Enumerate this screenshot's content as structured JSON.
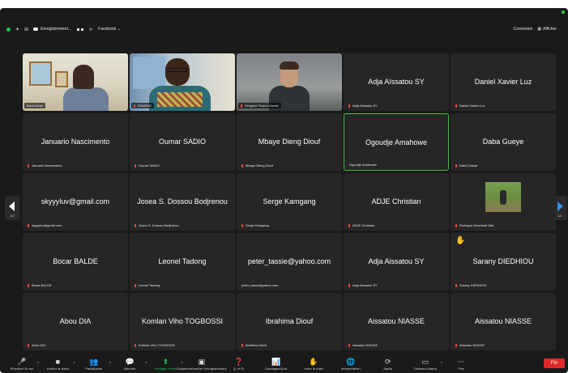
{
  "topbar": {
    "recording": "Enregistrement...",
    "view_menu": "Facebook",
    "sign_in": "Connexion",
    "view_toggle": "Afficher"
  },
  "grid": [
    [
      {
        "kind": "video",
        "video": "vid1",
        "label": "Bara Dème",
        "muted": false
      },
      {
        "kind": "video",
        "video": "vid2",
        "label": "RAMPAO",
        "muted": true
      },
      {
        "kind": "video",
        "video": "vid3",
        "label": "Grégoire Touron-Gardic",
        "muted": true
      },
      {
        "kind": "name",
        "name": "Adja Aïssatou SY",
        "label": "Adja Aïssatou SY",
        "muted": true
      },
      {
        "kind": "name",
        "name": "Daniel Xavier Luz",
        "label": "Daniel Xavier Luz",
        "muted": true
      }
    ],
    [
      {
        "kind": "name",
        "name": "Januario Nascimento",
        "label": "Januario Nascimento",
        "muted": true
      },
      {
        "kind": "name",
        "name": "Oumar SADIO",
        "label": "Oumar SADIO",
        "muted": true
      },
      {
        "kind": "name",
        "name": "Mbaye Dieng Diouf",
        "label": "Mbaye Dieng Diouf",
        "muted": true
      },
      {
        "kind": "name",
        "name": "Ogoudje Amahowe",
        "label": "Ogoudje Amahowe",
        "muted": false,
        "active": true
      },
      {
        "kind": "name",
        "name": "Daba Gueye",
        "label": "Daba Gueye",
        "muted": true
      }
    ],
    [
      {
        "kind": "name",
        "name": "skyyyluv@gmail.com",
        "label": "skyyyluv@gmail.com",
        "muted": true
      },
      {
        "kind": "name",
        "name": "Josea S. Dossou Bodjrenou",
        "label": "Josea S. Dossou Bodjrenou",
        "muted": true
      },
      {
        "kind": "name",
        "name": "Serge Kamgang",
        "label": "Serge Kamgang",
        "muted": true
      },
      {
        "kind": "name",
        "name": "ADJE Christian",
        "label": "ADJE Christian",
        "muted": true
      },
      {
        "kind": "photo",
        "label": "Rodrigue Mourbeté Sali",
        "muted": true
      }
    ],
    [
      {
        "kind": "name",
        "name": "Bocar BALDE",
        "label": "Bocar BALDE",
        "muted": true
      },
      {
        "kind": "name",
        "name": "Leonel Tadong",
        "label": "Leonel Tadong",
        "muted": true
      },
      {
        "kind": "name",
        "name": "peter_tassie@yahoo.com",
        "label": "peter_tassie@yahoo.com",
        "muted": false
      },
      {
        "kind": "name",
        "name": "Adja Aissatou SY",
        "label": "Adja Aissatou SY",
        "muted": true
      },
      {
        "kind": "name",
        "name": "Sarany DIEDHIOU",
        "label": "Sarany DIEDHIOU",
        "muted": true,
        "hand": true
      }
    ],
    [
      {
        "kind": "name",
        "name": "Abou DIA",
        "label": "Abou DIA",
        "muted": true
      },
      {
        "kind": "name",
        "name": "Komlan Viho TOGBOSSI",
        "label": "Komlan Viho TOGBOSSI",
        "muted": true
      },
      {
        "kind": "name",
        "name": "Ibrahima Diouf",
        "label": "Ibrahima Diouf",
        "muted": true
      },
      {
        "kind": "name",
        "name": "Aissatou NIASSE",
        "label": "Aissatou NIASSE",
        "muted": true
      },
      {
        "kind": "name",
        "name": "Aissatou NIASSE",
        "label": "Aissatou NIASSE",
        "muted": true
      }
    ]
  ],
  "pager": {
    "left": "1/2",
    "right": "1/2"
  },
  "toolbar": [
    {
      "id": "mic",
      "icon": "mic-muted-icon",
      "glyph": "🎤",
      "label": "Réactiver le son",
      "red": true,
      "caret": true
    },
    {
      "id": "video",
      "icon": "video-icon",
      "glyph": "■",
      "label": "Arrêter la vidéo",
      "caret": true
    },
    {
      "id": "participants",
      "icon": "participants-icon",
      "glyph": "👥",
      "label": "Participants",
      "caret": true
    },
    {
      "id": "chat",
      "icon": "chat-icon",
      "glyph": "💬",
      "label": "Discuter",
      "caret": true
    },
    {
      "id": "share",
      "icon": "share-screen-icon",
      "glyph": "⬆",
      "label": "Partager l'écran",
      "green": true,
      "caret": true
    },
    {
      "id": "summary",
      "icon": "summary-icon",
      "glyph": "▣",
      "label": "Suspendre/arrêter l'enregistrement"
    },
    {
      "id": "qa",
      "icon": "qa-icon",
      "glyph": "❓",
      "label": "Q. et R."
    },
    {
      "id": "polls",
      "icon": "polls-icon",
      "glyph": "📊",
      "label": "Sondages/Quiz"
    },
    {
      "id": "raise",
      "icon": "raise-hand-icon",
      "glyph": "✋",
      "label": "Lever la main"
    },
    {
      "id": "interp",
      "icon": "globe-icon",
      "glyph": "🌐",
      "label": "Interprétation"
    },
    {
      "id": "apps",
      "icon": "apps-icon",
      "glyph": "⟳",
      "label": "Applis"
    },
    {
      "id": "whiteboard",
      "icon": "whiteboard-icon",
      "glyph": "▭",
      "label": "Tableaux blancs",
      "caret": true
    },
    {
      "id": "more",
      "icon": "more-icon",
      "glyph": "⋯",
      "label": "Plus"
    }
  ],
  "end_button": "Fin"
}
